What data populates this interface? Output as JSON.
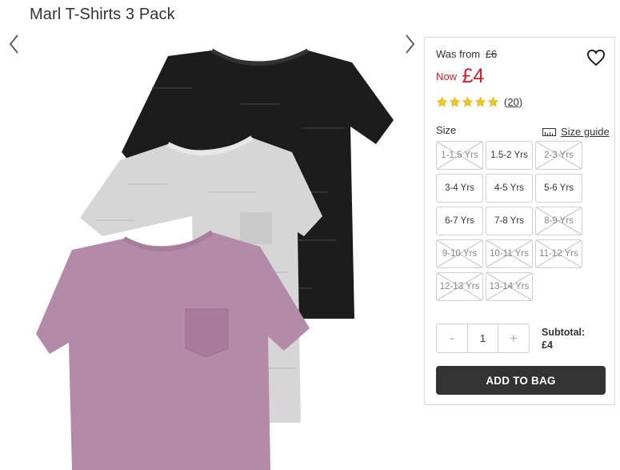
{
  "product": {
    "title": "Marl T-Shirts 3 Pack"
  },
  "price": {
    "was_label": "Was from",
    "was_price": "£6",
    "now_label": "Now",
    "now_price": "£4",
    "color": "#d11f25"
  },
  "rating": {
    "stars": 5,
    "max": 5,
    "review_count": "(20)",
    "star_color": "#f5c518"
  },
  "size": {
    "label": "Size",
    "guide_label": "Size guide",
    "options": [
      {
        "label": "1-1.5 Yrs",
        "available": false
      },
      {
        "label": "1.5-2 Yrs",
        "available": true
      },
      {
        "label": "2-3 Yrs",
        "available": false
      },
      {
        "label": "3-4 Yrs",
        "available": true
      },
      {
        "label": "4-5 Yrs",
        "available": true
      },
      {
        "label": "5-6 Yrs",
        "available": true
      },
      {
        "label": "6-7 Yrs",
        "available": true
      },
      {
        "label": "7-8 Yrs",
        "available": true
      },
      {
        "label": "8-9 Yrs",
        "available": false
      },
      {
        "label": "9-10 Yrs",
        "available": false
      },
      {
        "label": "10-11 Yrs",
        "available": false
      },
      {
        "label": "11-12 Yrs",
        "available": false
      },
      {
        "label": "12-13 Yrs",
        "available": false
      },
      {
        "label": "13-14 Yrs",
        "available": false
      }
    ]
  },
  "quantity": {
    "minus": "-",
    "value": "1",
    "plus": "+"
  },
  "subtotal": {
    "label": "Subtotal:",
    "value": "£4"
  },
  "cart": {
    "add_label": "ADD TO BAG"
  },
  "icons": {
    "heart": "heart-icon",
    "prev": "chevron-left-icon",
    "next": "chevron-right-icon",
    "ruler": "ruler-icon",
    "star": "star-icon"
  },
  "colors": {
    "button_bg": "#333333",
    "tshirt_black": "#1c1c1c",
    "tshirt_grey": "#d6d6d6",
    "tshirt_pink": "#b38aa8"
  }
}
